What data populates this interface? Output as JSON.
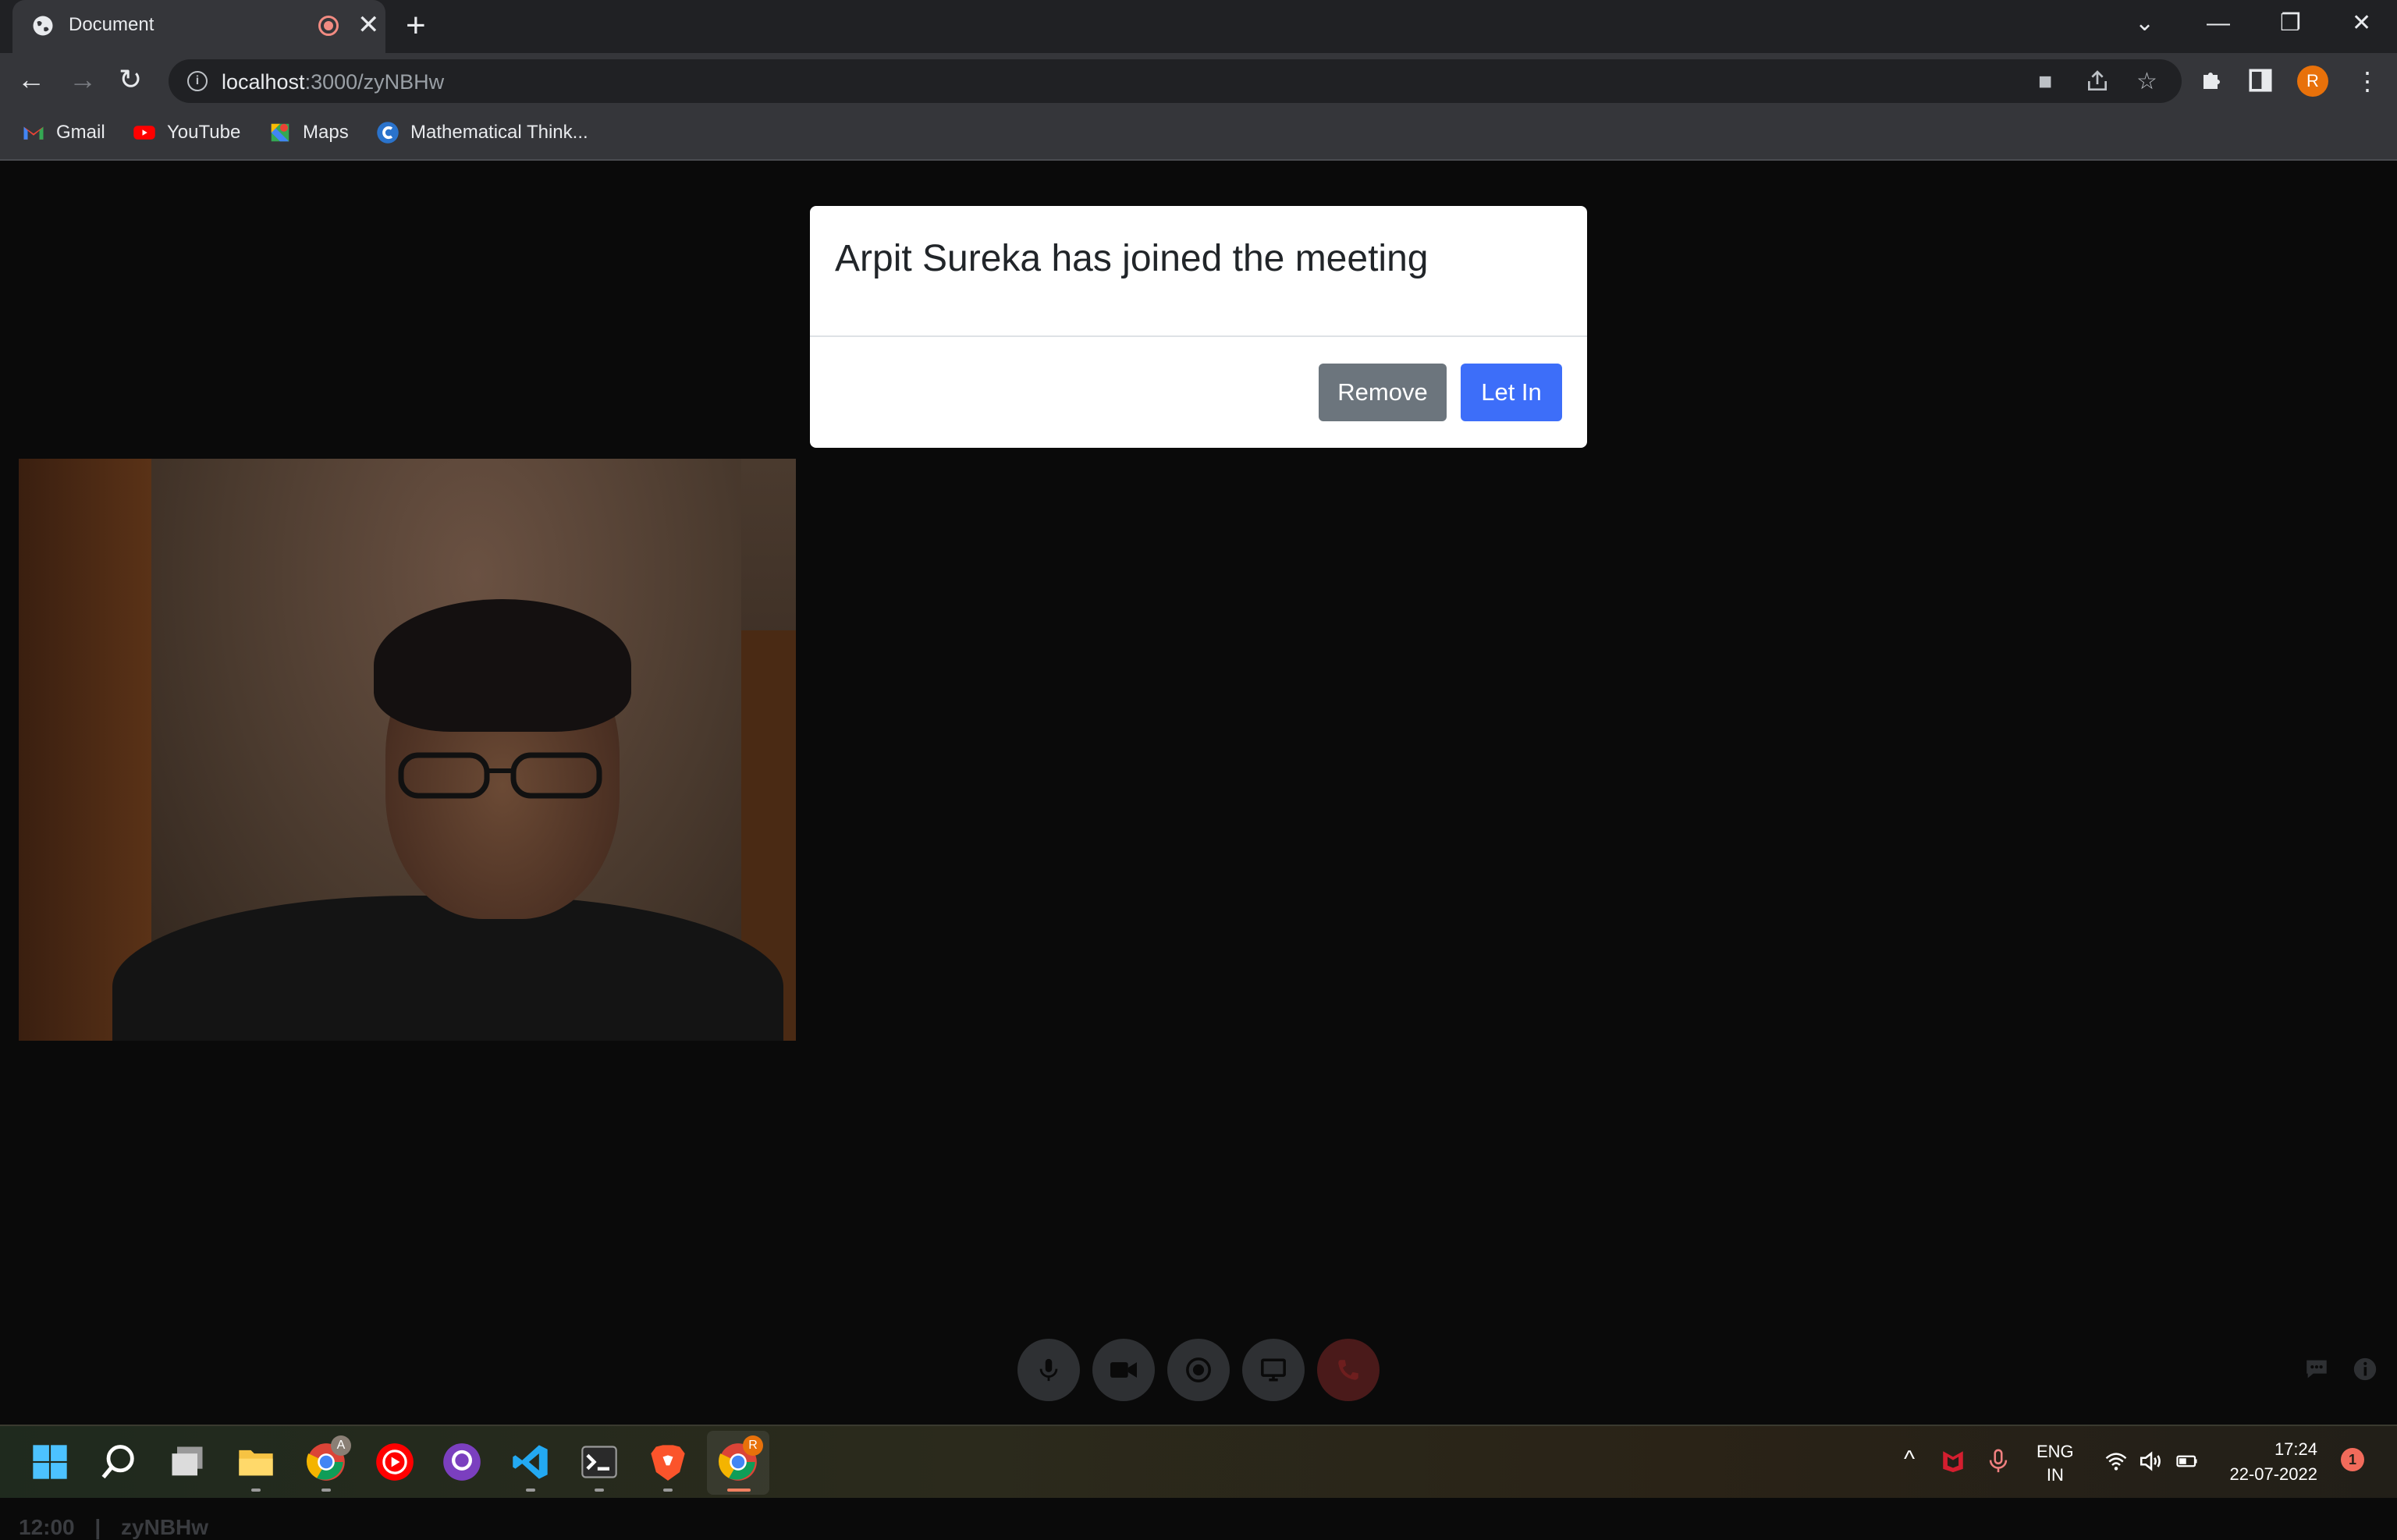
{
  "browser": {
    "tab_title": "Document",
    "tab_close": "✕",
    "new_tab": "+",
    "url_host": "localhost",
    "url_path": ":3000/zyNBHw",
    "profile_initial": "R",
    "bookmarks": [
      {
        "label": "Gmail",
        "icon": "gmail-icon"
      },
      {
        "label": "YouTube",
        "icon": "youtube-icon"
      },
      {
        "label": "Maps",
        "icon": "maps-icon"
      },
      {
        "label": "Mathematical Think...",
        "icon": "coursera-icon"
      }
    ]
  },
  "modal": {
    "message": "Arpit Sureka has joined the meeting",
    "remove_label": "Remove",
    "letin_label": "Let In"
  },
  "meeting": {
    "time": "12:00",
    "separator": "|",
    "code": "zyNBHw"
  },
  "controls": [
    "mic-icon",
    "camera-icon",
    "record-icon",
    "screen-share-icon",
    "end-call-icon"
  ],
  "taskbar": {
    "apps": [
      "windows-start-icon",
      "search-icon",
      "task-view-icon",
      "file-explorer-icon",
      "chrome-icon",
      "youtube-music-icon",
      "github-desktop-icon",
      "vscode-icon",
      "terminal-icon",
      "brave-icon",
      "chrome-icon"
    ],
    "chrome_badge_1": "A",
    "chrome_badge_2": "R",
    "lang_line1": "ENG",
    "lang_line2": "IN",
    "clock_time": "17:24",
    "clock_date": "22-07-2022",
    "notification_count": "1"
  },
  "colors": {
    "primary_button": "#3d6ef9",
    "secondary_button": "#6c757d",
    "page_background": "#0a0a0a"
  }
}
